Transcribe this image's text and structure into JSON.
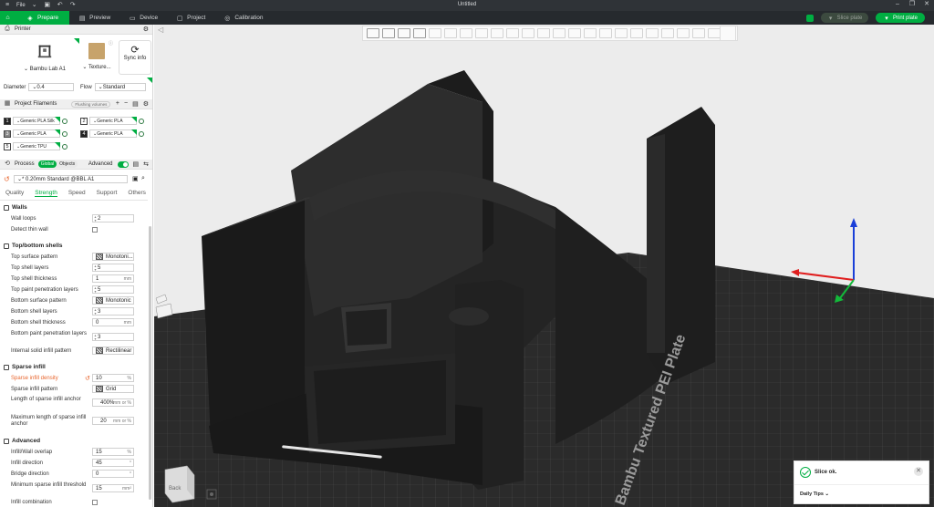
{
  "titlebar": {
    "file_menu": "File",
    "title": "Untitled"
  },
  "topbar": {
    "tabs": [
      {
        "label": "Prepare",
        "icon": "cube-icon"
      },
      {
        "label": "Preview",
        "icon": "layers-icon"
      },
      {
        "label": "Device",
        "icon": "monitor-icon"
      },
      {
        "label": "Project",
        "icon": "folder-icon"
      },
      {
        "label": "Calibration",
        "icon": "target-icon"
      }
    ],
    "slice_label": "Slice plate",
    "print_label": "Print plate",
    "accent": "#00ae42"
  },
  "printer": {
    "section": "Printer",
    "name": "Bambu Lab A1",
    "plate": "Texture...",
    "sync": "Sync info",
    "diameter_label": "Diameter",
    "diameter": "0.4",
    "flow_label": "Flow",
    "flow": "Standard"
  },
  "filaments": {
    "section": "Project Filaments",
    "flushing": "Flushing volumes",
    "items": [
      {
        "num": "1",
        "name": "Generic PLA Silk",
        "swatch": "#1a1a1a"
      },
      {
        "num": "2",
        "name": "Generic PLA",
        "swatch": "#ffffff"
      },
      {
        "num": "3",
        "name": "Generic PLA",
        "swatch": "#888888"
      },
      {
        "num": "4",
        "name": "Generic PLA",
        "swatch": "#1a1a1a"
      },
      {
        "num": "5",
        "name": "Generic TPU",
        "swatch": "#ffffff"
      }
    ]
  },
  "process": {
    "section": "Process",
    "global": "Global",
    "objects": "Objects",
    "advanced": "Advanced",
    "preset": "* 0.20mm Standard @BBL A1",
    "tabs": [
      "Quality",
      "Strength",
      "Speed",
      "Support",
      "Others"
    ]
  },
  "groups": {
    "walls": "Walls",
    "topbottom": "Top/bottom shells",
    "sparse": "Sparse infill",
    "advanced": "Advanced"
  },
  "options": {
    "wall_loops": {
      "label": "Wall loops",
      "value": "2"
    },
    "detect_thin": {
      "label": "Detect thin wall"
    },
    "top_surface_pattern": {
      "label": "Top surface pattern",
      "value": "Monotoni..."
    },
    "top_shell_layers": {
      "label": "Top shell layers",
      "value": "5"
    },
    "top_shell_thickness": {
      "label": "Top shell thickness",
      "value": "1",
      "unit": "mm"
    },
    "top_paint_layers": {
      "label": "Top paint penetration layers",
      "value": "5"
    },
    "bottom_surface_pattern": {
      "label": "Bottom surface pattern",
      "value": "Monotonic"
    },
    "bottom_shell_layers": {
      "label": "Bottom shell layers",
      "value": "3"
    },
    "bottom_shell_thickness": {
      "label": "Bottom shell thickness",
      "value": "0",
      "unit": "mm"
    },
    "bottom_paint_layers": {
      "label": "Bottom paint penetration layers",
      "value": "3"
    },
    "internal_solid_pattern": {
      "label": "Internal solid infill pattern",
      "value": "Rectilinear"
    },
    "sparse_density": {
      "label": "Sparse infill density",
      "value": "10",
      "unit": "%"
    },
    "sparse_pattern": {
      "label": "Sparse infill pattern",
      "value": "Grid"
    },
    "anchor_length": {
      "label": "Length of sparse infill anchor",
      "value": "400%",
      "unit": "mm or %"
    },
    "anchor_max": {
      "label": "Maximum length of sparse infill anchor",
      "value": "20",
      "unit": "mm or %"
    },
    "infill_overlap": {
      "label": "Infill/Wall overlap",
      "value": "15",
      "unit": "%"
    },
    "infill_direction": {
      "label": "Infill direction",
      "value": "45",
      "unit": "°"
    },
    "bridge_direction": {
      "label": "Bridge direction",
      "value": "0",
      "unit": "°"
    },
    "min_sparse_threshold": {
      "label": "Minimum sparse infill threshold",
      "value": "15",
      "unit": "mm²"
    },
    "infill_combination": {
      "label": "Infill combination"
    }
  },
  "viewport": {
    "plate_text": "Bambu Textured PEI Plate",
    "view_cube": "Back"
  },
  "toast": {
    "message": "Slice ok.",
    "tips": "Daily Tips"
  }
}
